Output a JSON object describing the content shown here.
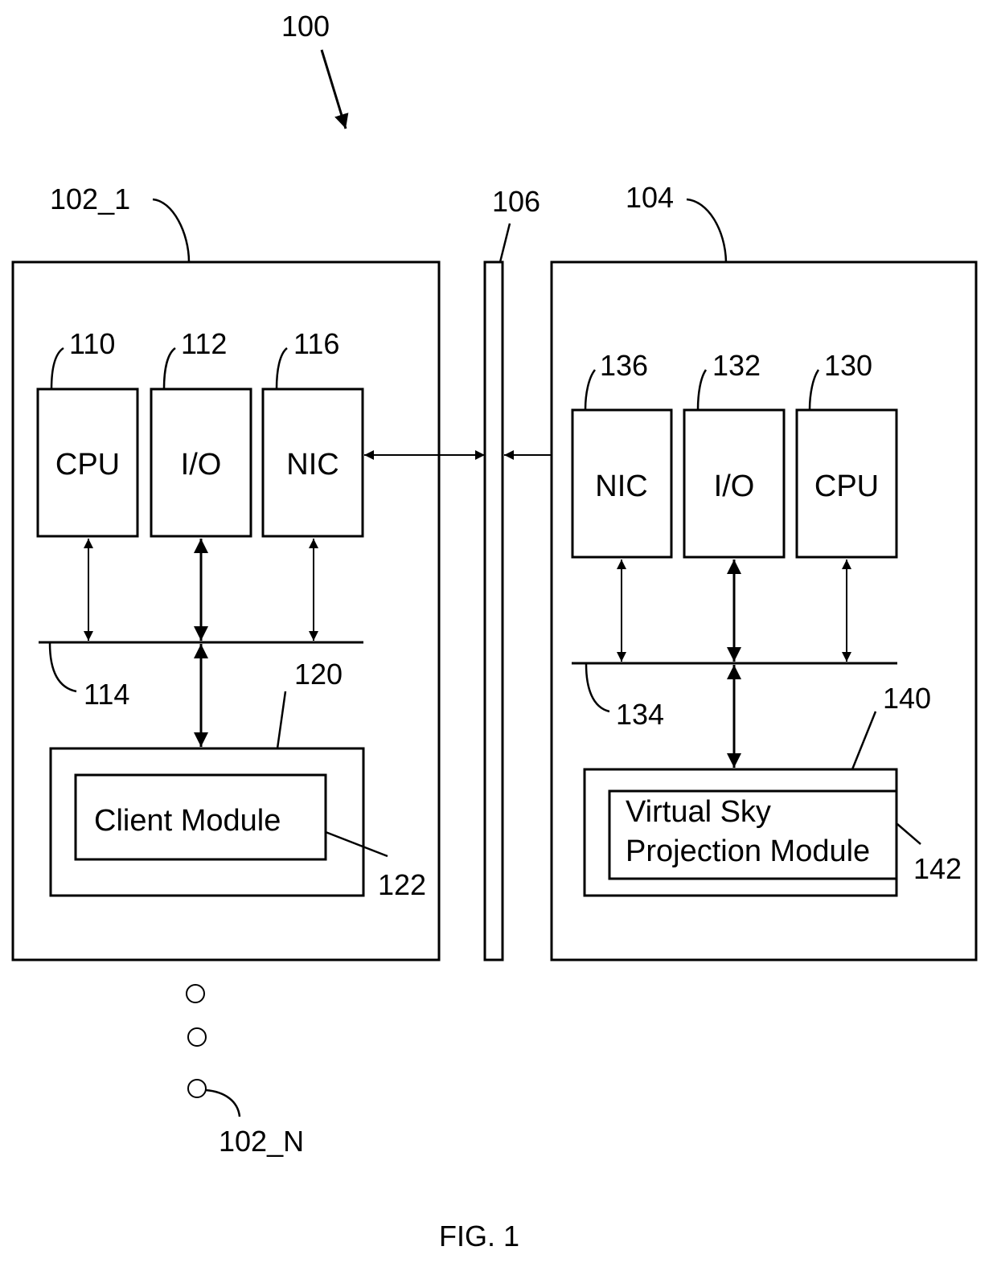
{
  "figure": {
    "caption": "FIG. 1",
    "system_ref": "100"
  },
  "client": {
    "ref": "102_1",
    "components": [
      {
        "ref": "110",
        "label": "CPU"
      },
      {
        "ref": "112",
        "label": "I/O"
      },
      {
        "ref": "116",
        "label": "NIC"
      }
    ],
    "bus_ref": "114",
    "memory_ref": "120",
    "module": {
      "ref": "122",
      "label": "Client Module"
    },
    "last_client_ref": "102_N"
  },
  "network": {
    "ref": "106"
  },
  "server": {
    "ref": "104",
    "components": [
      {
        "ref": "136",
        "label": "NIC"
      },
      {
        "ref": "132",
        "label": "I/O"
      },
      {
        "ref": "130",
        "label": "CPU"
      }
    ],
    "bus_ref": "134",
    "memory_ref": "140",
    "module": {
      "ref": "142",
      "line1": "Virtual Sky",
      "line2": "Projection Module"
    }
  }
}
